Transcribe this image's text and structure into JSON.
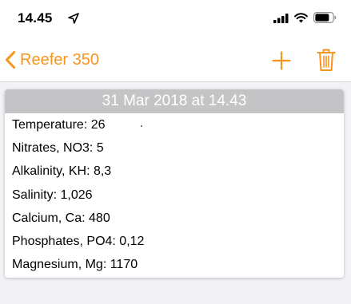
{
  "status_bar": {
    "time": "14.45",
    "icons": [
      "location-arrow-icon",
      "cellular-signal-icon",
      "wifi-icon",
      "battery-icon"
    ]
  },
  "nav": {
    "back_label": "Reefer 350",
    "actions": [
      "plus-icon",
      "trash-icon"
    ],
    "accent_color": "#f7941d"
  },
  "entry": {
    "header": "31 Mar 2018 at 14.43",
    "header_color": "#c4c4c6",
    "measurements": [
      "Temperature: 26",
      "Nitrates, NO3: 5",
      "Alkalinity, KH: 8,3",
      "Salinity: 1,026",
      "Calcium, Ca: 480",
      "Phosphates, PO4: 0,12",
      "Magnesium, Mg: 1170"
    ]
  }
}
